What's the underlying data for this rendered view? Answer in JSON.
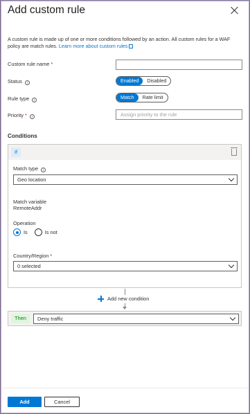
{
  "panel": {
    "title": "Add custom rule",
    "description": "A custom rule is made up of one or more conditions followed by an action. All custom rules for a WAF policy are match rules.",
    "learn_more_link": "Learn more about custom rules"
  },
  "form": {
    "rule_name_label": "Custom rule name",
    "rule_name_value": "",
    "status_label": "Status",
    "status_options": [
      "Enabled",
      "Disabled"
    ],
    "status_selected": "Enabled",
    "rule_type_label": "Rule type",
    "rule_type_options": [
      "Match",
      "Rate limit"
    ],
    "rule_type_selected": "Match",
    "priority_label": "Priority",
    "priority_placeholder": "Assign priority to the rule",
    "required_marker": "*",
    "info_glyph": "i"
  },
  "conditions": {
    "section_title": "Conditions",
    "if_badge": "If",
    "match_type_label": "Match type",
    "match_type_value": "Geo location",
    "match_variable_label": "Match variable",
    "match_variable_value": "RemoteAddr",
    "operation_label": "Operation",
    "operation_options": [
      "Is",
      "Is not"
    ],
    "operation_selected": "Is",
    "country_label": "Country/Region",
    "country_value": "0 selected",
    "add_condition_label": "Add new condition"
  },
  "action": {
    "then_badge": "Then",
    "value": "Deny traffic"
  },
  "footer": {
    "add_label": "Add",
    "cancel_label": "Cancel"
  },
  "icons": {
    "close": "close-icon",
    "info": "info-icon",
    "external_link": "external-link-icon",
    "trash": "trash-icon",
    "chevron": "chevron-down-icon",
    "plus": "plus-icon"
  },
  "colors": {
    "accent": "#0078d4",
    "required": "#a4262c",
    "then_badge_bg": "#dff6dd",
    "then_badge_text": "#107c10",
    "if_badge_bg": "#deecf9"
  }
}
